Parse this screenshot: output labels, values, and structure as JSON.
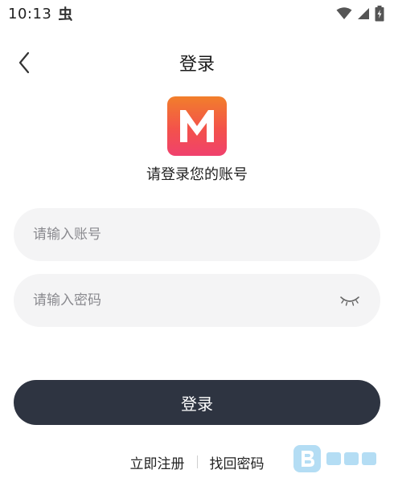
{
  "status_bar": {
    "time": "10:13",
    "bug_glyph": "虫",
    "icons": [
      "wifi-icon",
      "signal-icon",
      "battery-charging-icon"
    ]
  },
  "header": {
    "title": "登录",
    "back_icon": "chevron-left-icon"
  },
  "logo": {
    "letter": "M",
    "colors": [
      "#f27f2b",
      "#f3524b",
      "#f0416d"
    ]
  },
  "subtitle": "请登录您的账号",
  "form": {
    "account": {
      "placeholder": "请输入账号",
      "value": ""
    },
    "password": {
      "placeholder": "请输入密码",
      "value": "",
      "toggle_icon": "eye-closed-icon"
    }
  },
  "login_button": {
    "label": "登录",
    "color": "#2e3441"
  },
  "links": {
    "register": "立即注册",
    "forgot": "找回密码"
  },
  "watermark": {
    "icon": "b-logo-icon"
  }
}
